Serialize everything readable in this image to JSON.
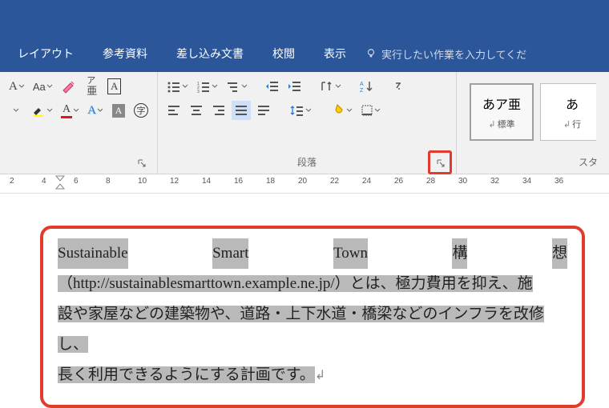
{
  "tabs": {
    "layout": "レイアウト",
    "references": "参考資料",
    "mailings": "差し込み文書",
    "review": "校閲",
    "view": "表示",
    "tellme": "実行したい作業を入力してくだ"
  },
  "groups": {
    "font_label": "",
    "paragraph_label": "段落",
    "styles_label": "スタ"
  },
  "styles": {
    "normal_preview": "あア亜",
    "normal_name": "標準",
    "next_preview": "あ",
    "next_name": "行"
  },
  "ruler": {
    "ticks": [
      2,
      4,
      6,
      8,
      10,
      12,
      14,
      16,
      18,
      20,
      22,
      24,
      26,
      28,
      30,
      32,
      34,
      36
    ]
  },
  "document": {
    "w1": "Sustainable",
    "w2": "Smart",
    "w3": "Town",
    "w4": "構",
    "w5": "想",
    "line2": "（http://sustainablesmarttown.example.ne.jp/）とは、極力費用を抑え、施",
    "line3": "設や家屋などの建築物や、道路・上下水道・橋梁などのインフラを改修し、",
    "line4": "長く利用できるようにする計画です。"
  }
}
